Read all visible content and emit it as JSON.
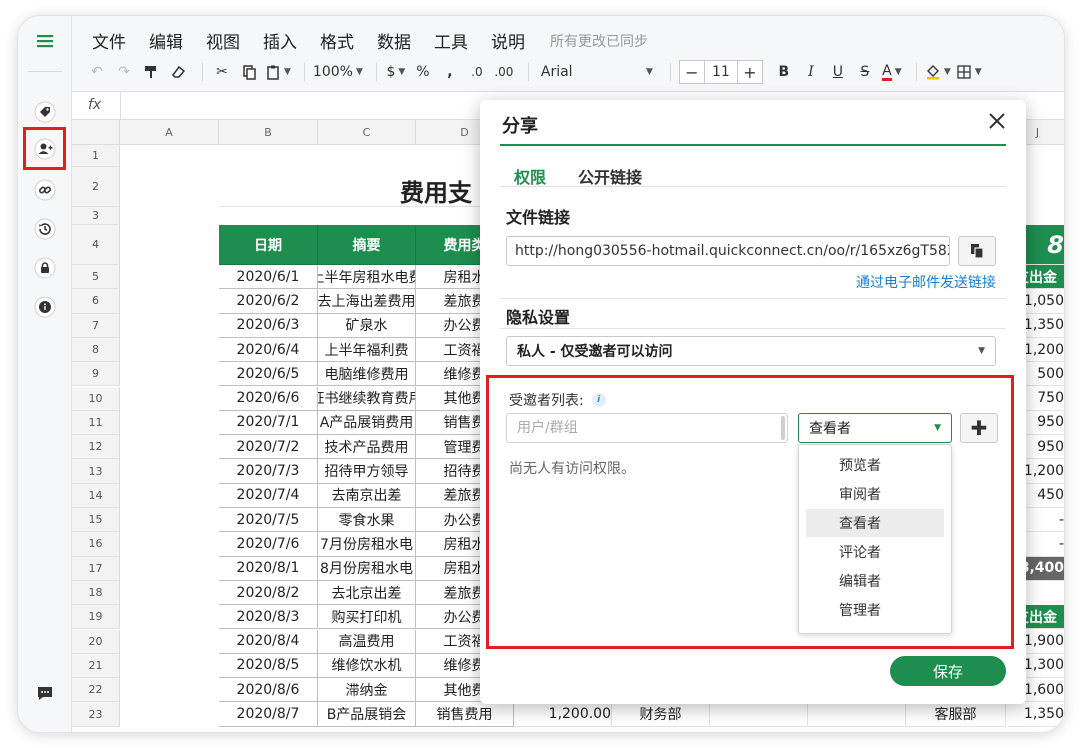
{
  "menu": {
    "items": [
      "文件",
      "编辑",
      "视图",
      "插入",
      "格式",
      "数据",
      "工具",
      "说明"
    ],
    "sync_status": "所有更改已同步"
  },
  "toolbar": {
    "zoom": "100%",
    "currency": "$",
    "percent": "%",
    "comma": ",",
    "dec_less": ".0",
    "dec_more": ".00",
    "font": "Arial",
    "font_size": "11",
    "minus": "−",
    "plus": "+",
    "bold": "B",
    "italic": "I",
    "underline": "U",
    "strike": "S",
    "text_color": "A"
  },
  "formula_bar": {
    "label": "fx"
  },
  "columns": [
    "A",
    "B",
    "C",
    "D",
    "J"
  ],
  "row_numbers": [
    "1",
    "2",
    "3",
    "4",
    "5",
    "6",
    "7",
    "8",
    "9",
    "10",
    "11",
    "12",
    "13",
    "14",
    "15",
    "16",
    "17",
    "18",
    "19",
    "20",
    "21",
    "22",
    "23"
  ],
  "sheet": {
    "title": "费用支",
    "headers": [
      "日期",
      "摘要",
      "费用类"
    ],
    "rows": [
      [
        "2020/6/1",
        "上半年房租水电费",
        "房租水"
      ],
      [
        "2020/6/2",
        "去上海出差费用",
        "差旅费"
      ],
      [
        "2020/6/3",
        "矿泉水",
        "办公费"
      ],
      [
        "2020/6/4",
        "上半年福利费",
        "工资福"
      ],
      [
        "2020/6/5",
        "电脑维修费用",
        "维修费"
      ],
      [
        "2020/6/6",
        "证书继续教育费用",
        "其他费"
      ],
      [
        "2020/7/1",
        "A产品展销费用",
        "销售费"
      ],
      [
        "2020/7/2",
        "技术产品费用",
        "管理费"
      ],
      [
        "2020/7/3",
        "招待甲方领导",
        "招待费"
      ],
      [
        "2020/7/4",
        "去南京出差",
        "差旅费"
      ],
      [
        "2020/7/5",
        "零食水果",
        "办公费"
      ],
      [
        "2020/7/6",
        "7月份房租水电",
        "房租水"
      ],
      [
        "2020/8/1",
        "8月份房租水电",
        "房租水"
      ],
      [
        "2020/8/2",
        "去北京出差",
        "差旅费"
      ],
      [
        "2020/8/3",
        "购买打印机",
        "办公费"
      ],
      [
        "2020/8/4",
        "高温费用",
        "工资福"
      ],
      [
        "2020/8/5",
        "维修饮水机",
        "维修费"
      ],
      [
        "2020/8/6",
        "滞纳金",
        "其他费"
      ],
      [
        "2020/8/7",
        "B产品展销会",
        "销售费用"
      ]
    ],
    "row23_extra": {
      "amount": "1,200.00",
      "dept": "财务部",
      "right_dept": "客服部",
      "right_amount": "1,350"
    },
    "right_col": {
      "big_value": "8",
      "header1": "支出金",
      "values1": [
        "1,050",
        "1,350",
        "1,200",
        "500",
        "750",
        "950",
        "950",
        "1,200",
        "450",
        "-",
        "-"
      ],
      "total": "8,400",
      "header2": "支出金",
      "values2": [
        "1,900",
        "1,300",
        "1,600"
      ]
    }
  },
  "share_dialog": {
    "title": "分享",
    "tabs": [
      "权限",
      "公开链接"
    ],
    "file_link_title": "文件链接",
    "file_link_url": "http://hong030556-hotmail.quickconnect.cn/oo/r/165xz6gT582p",
    "email_link": "通过电子邮件发送链接",
    "privacy_title": "隐私设置",
    "privacy_value": "私人 - 仅受邀者可以访问",
    "invite_label": "受邀者列表:",
    "info": "i",
    "user_placeholder": "用户/群组",
    "role_value": "查看者",
    "no_access": "尚无人有访问权限。",
    "role_options": [
      "预览者",
      "审阅者",
      "查看者",
      "评论者",
      "编辑者",
      "管理者"
    ],
    "save_label": "保存"
  },
  "colors": {
    "accent": "#1e8e4f",
    "highlight": "#e0201f",
    "link": "#1a7fd0"
  }
}
